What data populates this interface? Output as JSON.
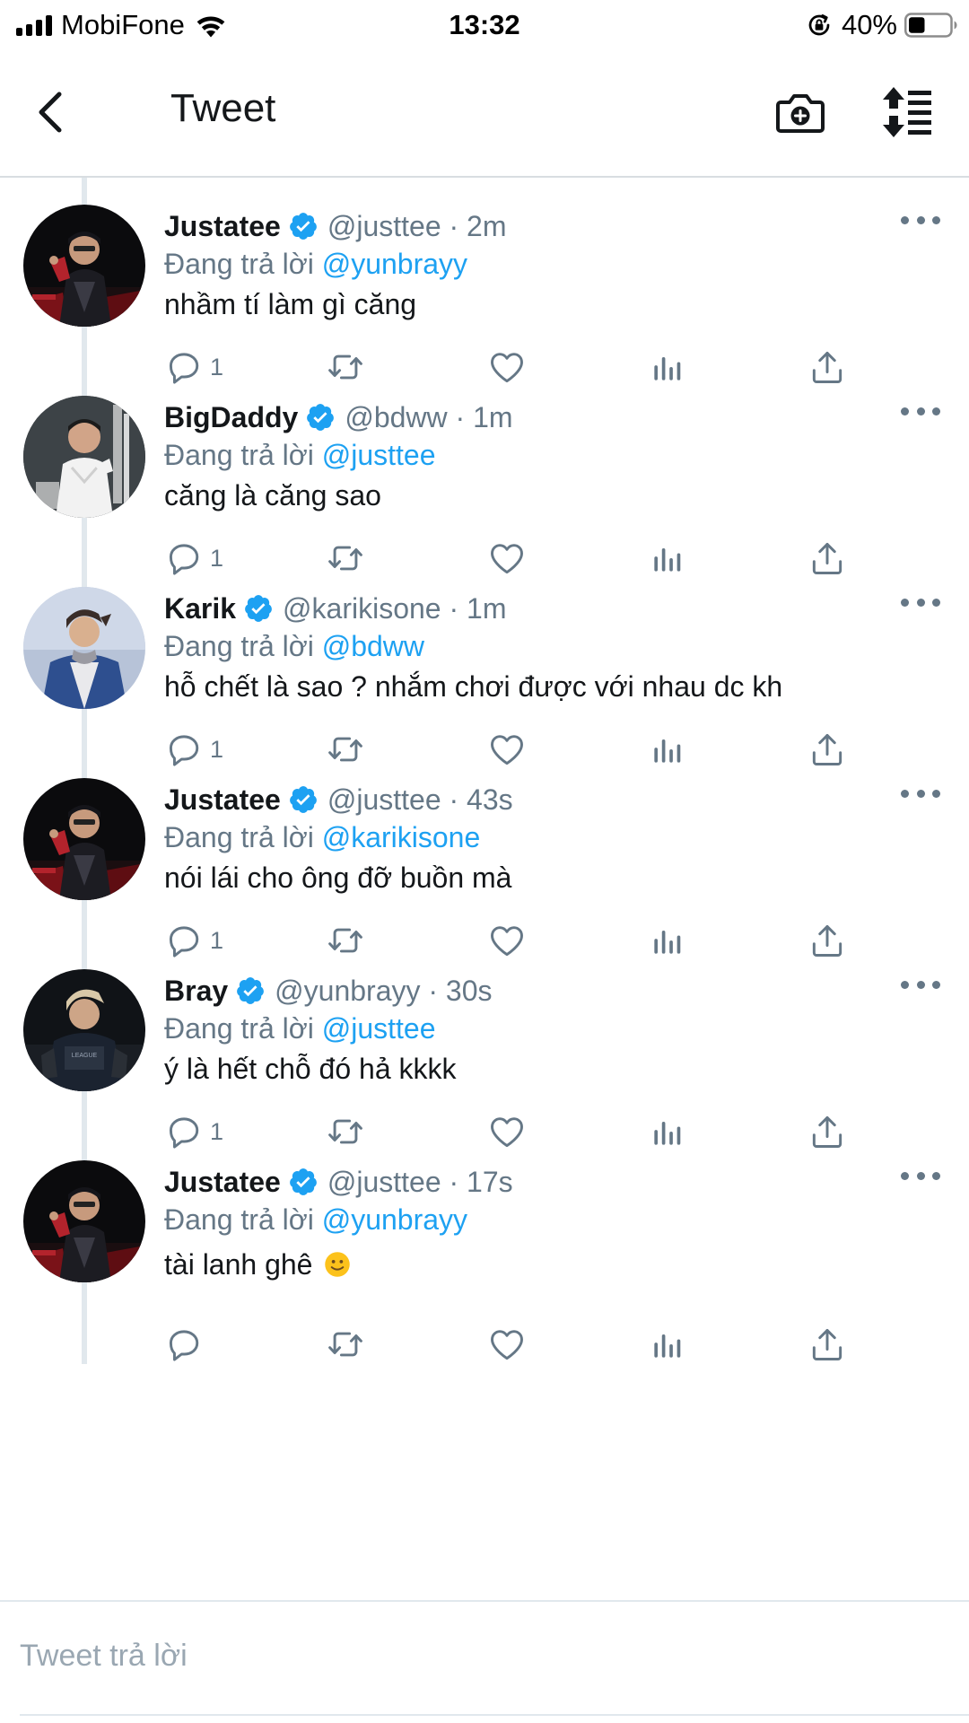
{
  "status_bar": {
    "carrier": "MobiFone",
    "time": "13:32",
    "battery_percent": "40%",
    "battery_level": 0.4,
    "icons": [
      "signal-icon",
      "wifi-icon",
      "orientation-lock-icon",
      "battery-icon"
    ]
  },
  "header": {
    "title": "Tweet",
    "icons": [
      "back-chevron-icon",
      "camera-plus-icon",
      "sort-icon"
    ]
  },
  "tweets": [
    {
      "name": "Justatee",
      "handle": "@justtee · 2m",
      "reply_prefix": "Đang trả lời",
      "reply_to": "@yunbrayy",
      "text": "nhầm tí làm gì căng",
      "reply_count": "1",
      "avatar": "photo-justatee"
    },
    {
      "name": "BigDaddy",
      "handle": "@bdww · 1m",
      "reply_prefix": "Đang trả lời",
      "reply_to": "@justtee",
      "text": "căng là căng sao",
      "reply_count": "1",
      "avatar": "photo-bigdaddy"
    },
    {
      "name": "Karik",
      "handle": "@karikisone · 1m",
      "reply_prefix": "Đang trả lời",
      "reply_to": "@bdww",
      "text": "hỗ chết là sao ? nhắm chơi được với nhau dc kh",
      "reply_count": "1",
      "avatar": "photo-karik"
    },
    {
      "name": "Justatee",
      "handle": "@justtee · 43s",
      "reply_prefix": "Đang trả lời",
      "reply_to": "@karikisone",
      "text": "nói lái cho ông đỡ buồn mà",
      "reply_count": "1",
      "avatar": "photo-justatee"
    },
    {
      "name": "Bray",
      "handle": "@yunbrayy · 30s",
      "reply_prefix": "Đang trả lời",
      "reply_to": "@justtee",
      "text": "ý là hết chỗ đó hả kkkk",
      "reply_count": "1",
      "avatar": "photo-bray"
    },
    {
      "name": "Justatee",
      "handle": "@justtee · 17s",
      "reply_prefix": "Đang trả lời",
      "reply_to": "@yunbrayy",
      "text": "tài lanh ghê",
      "emoji": "slightly-smiling-face",
      "reply_count": "",
      "avatar": "photo-justatee"
    }
  ],
  "compose": {
    "placeholder": "Tweet trả lời"
  },
  "colors": {
    "accent": "#1da1f2",
    "text": "#14171a",
    "secondary_text": "#657786",
    "divider": "#e1e8ed",
    "verified": "#1da1f2"
  }
}
